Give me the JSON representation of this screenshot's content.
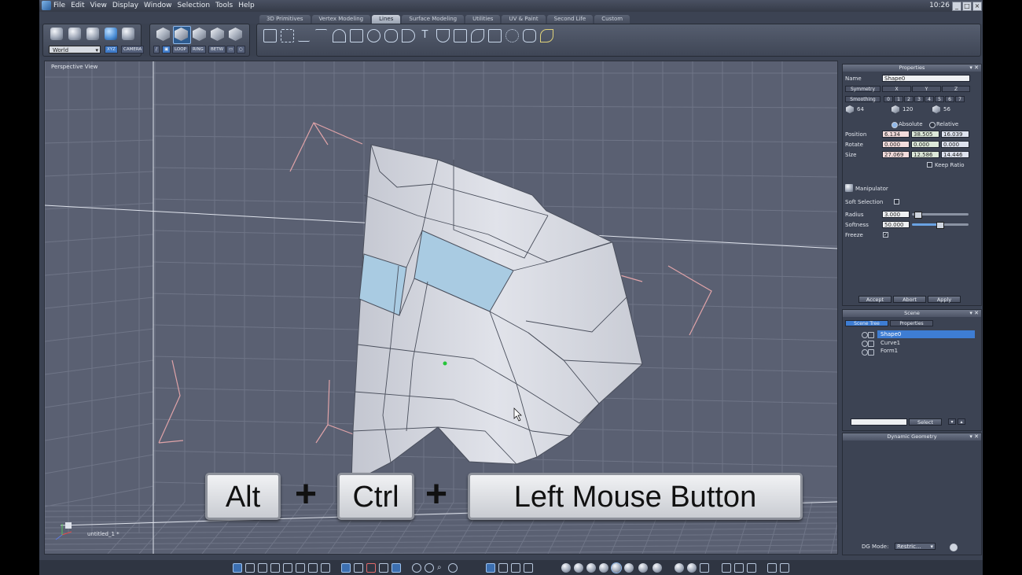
{
  "menubar": {
    "menus": [
      "File",
      "Edit",
      "View",
      "Display",
      "Window",
      "Selection",
      "Tools",
      "Help"
    ],
    "clock": "10:26"
  },
  "tabs": [
    "3D Primitives",
    "Vertex Modeling",
    "Lines",
    "Surface Modeling",
    "Utilities",
    "UV & Paint",
    "Second Life",
    "Custom"
  ],
  "active_tab": "Lines",
  "toolbar": {
    "coord_space": "World",
    "xyz_label": "XYZ",
    "camera_label": "CAMERA",
    "loop_label": "LOOP",
    "ring_label": "RING",
    "betw_label": "BETW"
  },
  "viewport": {
    "label": "Perspective View",
    "file_label": "untitled_1 *"
  },
  "shortcut": {
    "key1": "Alt",
    "plus1": "+",
    "key2": "Ctrl",
    "plus2": "+",
    "key3": "Left Mouse Button"
  },
  "properties": {
    "title": "Properties",
    "name_label": "Name",
    "name_value": "Shape0",
    "symmetry_label": "Symmetry",
    "sym_axes": [
      "X",
      "Y",
      "Z"
    ],
    "smoothing_label": "Smoothing",
    "smoothing_levels": [
      "0",
      "1",
      "2",
      "3",
      "4",
      "5",
      "6",
      "7"
    ],
    "counts": [
      "64",
      "120",
      "56"
    ],
    "absolute_label": "Absolute",
    "relative_label": "Relative",
    "position_label": "Position",
    "position": [
      "6.134",
      "38.505",
      "16.039"
    ],
    "rotate_label": "Rotate",
    "rotate": [
      "0.000",
      "0.000",
      "0.000"
    ],
    "size_label": "Size",
    "size": [
      "27.069",
      "12.586",
      "14.446"
    ],
    "keep_ratio_label": "Keep Ratio",
    "manipulator_label": "Manipulator",
    "soft_selection_label": "Soft Selection",
    "radius_label": "Radius",
    "radius_value": "3.000",
    "softness_label": "Softness",
    "softness_value": "50.000",
    "freeze_label": "Freeze",
    "freeze_checked": "✓",
    "accept_label": "Accept",
    "abort_label": "Abort",
    "apply_label": "Apply"
  },
  "scene": {
    "title": "Scene",
    "tab_tree": "Scene Tree",
    "tab_props": "Properties",
    "items": [
      "Shape0",
      "Curve1",
      "Form1"
    ],
    "select_label": "Select"
  },
  "dynamic_geometry": {
    "title": "Dynamic Geometry",
    "dg_mode_label": "DG Mode:",
    "dg_mode_value": "Restric..."
  },
  "colors": {
    "selection_blue": "#3e7dd3",
    "face_highlight": "#a9cbe2",
    "pink_gizmo": "#e0a3a8"
  }
}
